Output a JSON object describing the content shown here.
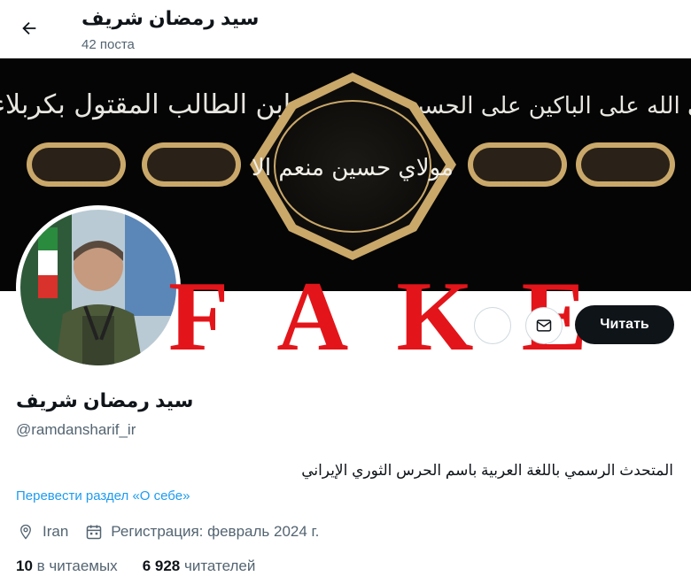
{
  "header": {
    "title": "سيد رمضان شريف",
    "post_count": "42 поста"
  },
  "banner": {
    "arabic_left": "ابن الطالب المقتول بكربلاء",
    "arabic_right": "صلى الله على الباكين على الحسين",
    "arabic_center": "مولاي حسين منعم الا"
  },
  "overlay": {
    "letters": [
      "F",
      "A",
      "K",
      "E"
    ]
  },
  "actions": {
    "follow_label": "Читать"
  },
  "profile": {
    "name": "سيد رمضان شريف",
    "handle": "@ramdansharif_ir",
    "bio": "المتحدث الرسمي باللغة العربية باسم الحرس الثوري الإيراني",
    "translate_link": "Перевести раздел «О себе»",
    "location": "Iran",
    "joined": "Регистрация: февраль 2024 г."
  },
  "stats": {
    "following_count": "10",
    "following_label": "в читаемых",
    "followers_count": "6 928",
    "followers_label": "читателей"
  },
  "colors": {
    "fake_red": "#e3151a",
    "link_blue": "#1d9bf0",
    "muted": "#536471",
    "follow_bg": "#0f1419",
    "banner_gold": "#c9a86a"
  }
}
